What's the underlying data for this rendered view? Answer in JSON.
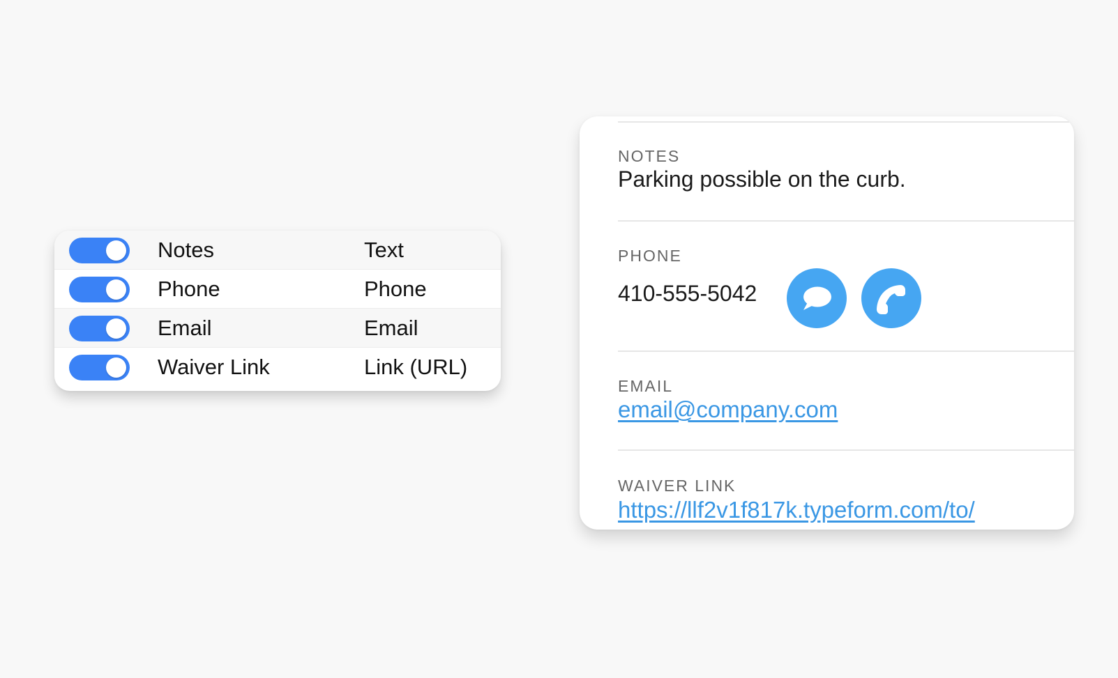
{
  "field_settings": {
    "rows": [
      {
        "name": "Notes",
        "type": "Text",
        "enabled": true
      },
      {
        "name": "Phone",
        "type": "Phone",
        "enabled": true
      },
      {
        "name": "Email",
        "type": "Email",
        "enabled": true
      },
      {
        "name": "Waiver Link",
        "type": "Link (URL)",
        "enabled": true
      }
    ],
    "toggle_color": "#3a82f6"
  },
  "contact_detail": {
    "notes": {
      "label": "NOTES",
      "value": "Parking possible on the curb."
    },
    "phone": {
      "label": "PHONE",
      "value": "410-555-5042",
      "actions": [
        {
          "icon": "message-bubble-icon"
        },
        {
          "icon": "phone-icon"
        }
      ]
    },
    "email": {
      "label": "EMAIL",
      "value": "email@company.com"
    },
    "waiver_link": {
      "label": "WAIVER LINK",
      "value": "https://llf2v1f817k.typeform.com/to/"
    },
    "accent_color": "#46a6f2",
    "link_color": "#3a97e4"
  }
}
